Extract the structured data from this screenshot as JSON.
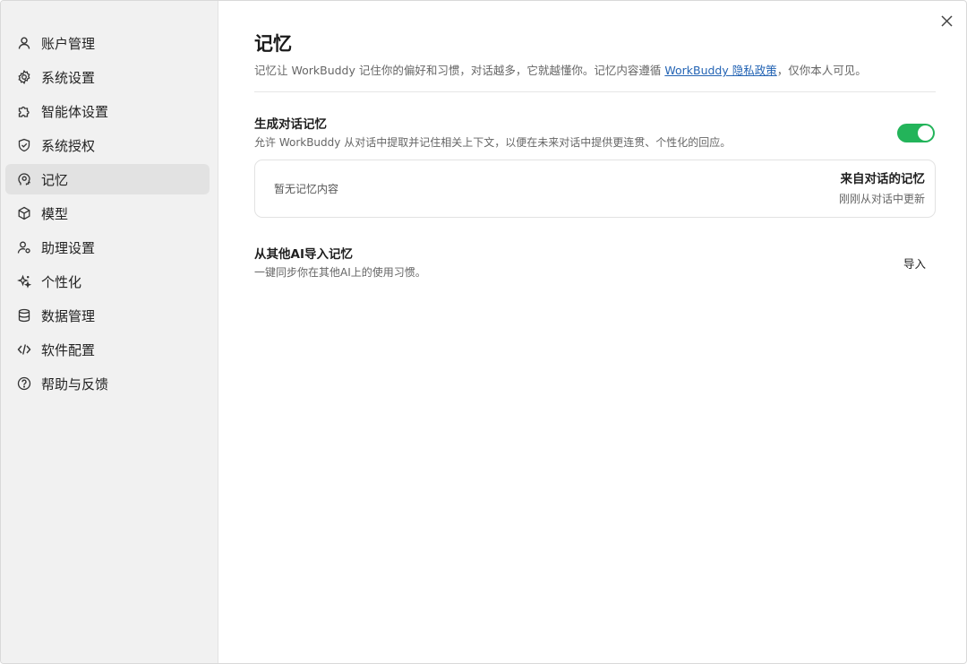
{
  "sidebar": {
    "items": [
      {
        "label": "账户管理",
        "icon": "user-icon"
      },
      {
        "label": "系统设置",
        "icon": "gear-icon"
      },
      {
        "label": "智能体设置",
        "icon": "puzzle-icon"
      },
      {
        "label": "系统授权",
        "icon": "shield-check-icon"
      },
      {
        "label": "记忆",
        "icon": "head-brain-icon",
        "active": true
      },
      {
        "label": "模型",
        "icon": "cube-icon"
      },
      {
        "label": "助理设置",
        "icon": "user-gear-icon"
      },
      {
        "label": "个性化",
        "icon": "sparkle-icon"
      },
      {
        "label": "数据管理",
        "icon": "database-icon"
      },
      {
        "label": "软件配置",
        "icon": "code-icon"
      },
      {
        "label": "帮助与反馈",
        "icon": "help-circle-icon"
      }
    ]
  },
  "main": {
    "title": "记忆",
    "description_prefix": "记忆让 WorkBuddy 记住你的偏好和习惯，对话越多，它就越懂你。记忆内容遵循 ",
    "privacy_link": "WorkBuddy 隐私政策",
    "description_suffix": "，仅你本人可见。",
    "generate": {
      "title": "生成对话记忆",
      "subtitle": "允许 WorkBuddy 从对话中提取并记住相关上下文，以便在未来对话中提供更连贯、个性化的回应。",
      "enabled": true
    },
    "memory_box": {
      "empty_text": "暂无记忆内容",
      "source_title": "来自对话的记忆",
      "source_time": "刚刚从对话中更新"
    },
    "import": {
      "title": "从其他AI导入记忆",
      "subtitle": "一键同步你在其他AI上的使用习惯。",
      "button": "导入"
    }
  },
  "colors": {
    "accent_green": "#23b45a",
    "link_blue": "#2464b4",
    "sidebar_bg": "#f1f1f1",
    "active_item_bg": "#e2e2e2"
  }
}
